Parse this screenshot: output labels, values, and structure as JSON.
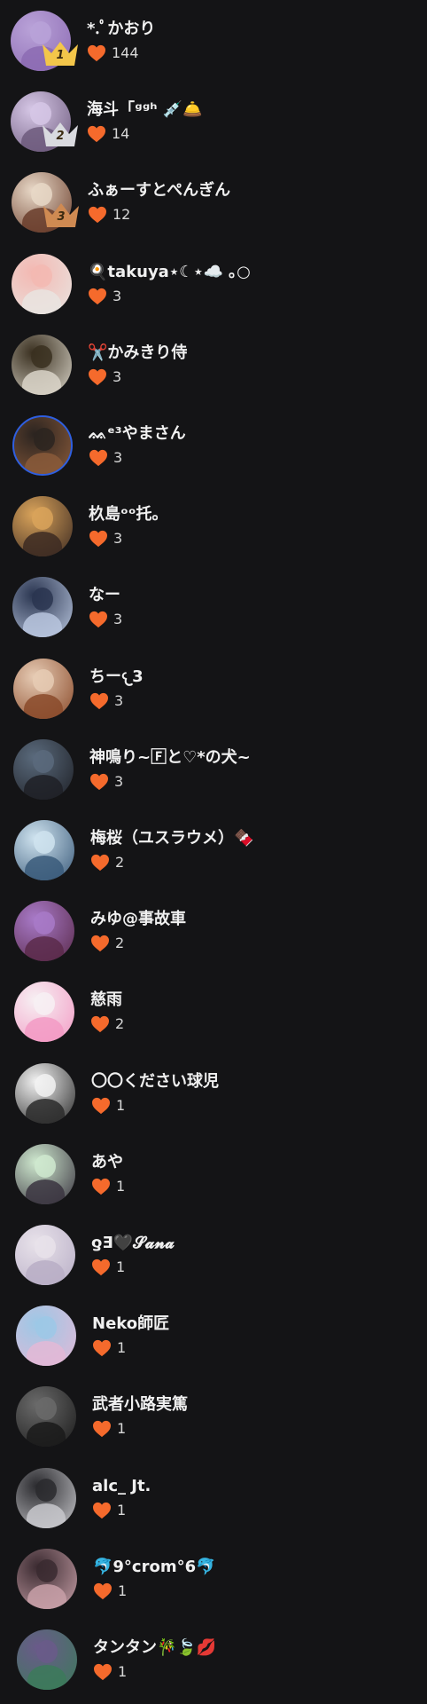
{
  "colors": {
    "background": "#141416",
    "heart": "#f56a2c",
    "gold_crown": "#f3c64a",
    "silver_crown": "#d9dadf",
    "bronze_crown": "#cf8a52"
  },
  "icons": {
    "like": "heart-icon",
    "rank_badge": "crown-icon"
  },
  "rankers": [
    {
      "rank": "1",
      "name": "*.ﾟかおり",
      "likes": "144",
      "avatar_colors": [
        "#b9a2d8",
        "#8c6bb3"
      ]
    },
    {
      "rank": "2",
      "name": "海斗「ᵍᵍʰ 💉🛎️",
      "likes": "14",
      "avatar_colors": [
        "#d6c7e6",
        "#6d5a7d"
      ]
    },
    {
      "rank": "3",
      "name": "ふぁーすとぺんぎん",
      "likes": "12",
      "avatar_colors": [
        "#e8d8c7",
        "#6a3d2b"
      ]
    },
    {
      "rank": "",
      "name": "🍳takuya⋆☾⋆☁️ ｡○",
      "likes": "3",
      "avatar_colors": [
        "#f3b8b2",
        "#e9e4e0"
      ]
    },
    {
      "rank": "",
      "name": "✂️かみきり侍",
      "likes": "3",
      "avatar_colors": [
        "#3a3020",
        "#d9d4c8"
      ]
    },
    {
      "rank": "",
      "name": "ᨐᵉ³やまさん",
      "likes": "3",
      "avatar_colors": [
        "#2b2420",
        "#8a5a3a"
      ]
    },
    {
      "rank": "",
      "name": "杦島ᵒᵒ托。",
      "likes": "3",
      "avatar_colors": [
        "#d9a35a",
        "#3c2a22"
      ]
    },
    {
      "rank": "",
      "name": "なー",
      "likes": "3",
      "avatar_colors": [
        "#2a3550",
        "#b9c6de"
      ]
    },
    {
      "rank": "",
      "name": "ちー𐔌3",
      "likes": "3",
      "avatar_colors": [
        "#e6cbb4",
        "#8a4a2a"
      ]
    },
    {
      "rank": "",
      "name": "神鳴り~🄵と♡*の犬~",
      "likes": "3",
      "avatar_colors": [
        "#5a6a7c",
        "#1e2026"
      ]
    },
    {
      "rank": "",
      "name": "梅桜（ユスラウメ）🍫",
      "likes": "2",
      "avatar_colors": [
        "#cfe3ef",
        "#3a5a7a"
      ]
    },
    {
      "rank": "",
      "name": "みゆ@事故車",
      "likes": "2",
      "avatar_colors": [
        "#a87ac8",
        "#5a2a4a"
      ]
    },
    {
      "rank": "",
      "name": "慈雨",
      "likes": "2",
      "avatar_colors": [
        "#f7f0f3",
        "#f29ac4"
      ]
    },
    {
      "rank": "",
      "name": "〇〇ください球児",
      "likes": "1",
      "avatar_colors": [
        "#f2f2f2",
        "#2a2a2a"
      ]
    },
    {
      "rank": "",
      "name": "あや",
      "likes": "1",
      "avatar_colors": [
        "#cfe9cf",
        "#3a3440"
      ]
    },
    {
      "rank": "",
      "name": "ƍƎ🖤𝓢𝓪𝓷𝓪",
      "likes": "1",
      "avatar_colors": [
        "#e8e2ea",
        "#b8aec6"
      ]
    },
    {
      "rank": "",
      "name": "Neko師匠",
      "likes": "1",
      "avatar_colors": [
        "#9cc8e6",
        "#e3b8d6"
      ]
    },
    {
      "rank": "",
      "name": "武者小路実篤",
      "likes": "1",
      "avatar_colors": [
        "#6a6a6a",
        "#1a1a1a"
      ]
    },
    {
      "rank": "",
      "name": "alc_ Jt.",
      "likes": "1",
      "avatar_colors": [
        "#2a2a2e",
        "#c8c8cc"
      ]
    },
    {
      "rank": "",
      "name": "🐬9°crom°6🐬",
      "likes": "1",
      "avatar_colors": [
        "#3a2a30",
        "#c8a0a8"
      ]
    },
    {
      "rank": "",
      "name": "タンタン🎋🍃💋",
      "likes": "1",
      "avatar_colors": [
        "#6a5a8a",
        "#3c7a5a"
      ]
    }
  ]
}
